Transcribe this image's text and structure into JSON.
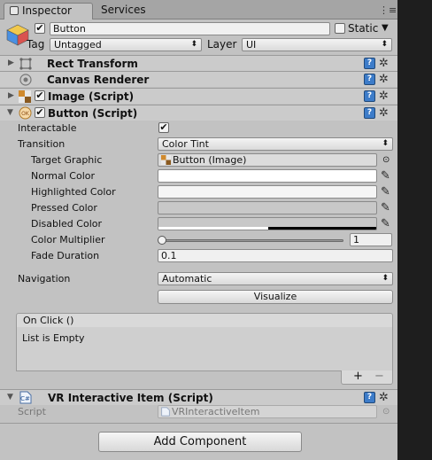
{
  "tabs": [
    {
      "label": "Inspector",
      "icon": "inspector-icon"
    },
    {
      "label": "Services"
    }
  ],
  "window_controls": {
    "menu": "⋮≡"
  },
  "gameobject": {
    "name": "Button",
    "active": true,
    "static_label": "Static",
    "tag_label": "Tag",
    "tag_value": "Untagged",
    "layer_label": "Layer",
    "layer_value": "UI"
  },
  "components": {
    "rect_transform": {
      "title": "Rect Transform"
    },
    "canvas_renderer": {
      "title": "Canvas Renderer"
    },
    "image": {
      "title": "Image (Script)",
      "enabled": true
    },
    "button": {
      "title": "Button (Script)",
      "enabled": true,
      "interactable_label": "Interactable",
      "interactable": true,
      "transition_label": "Transition",
      "transition_value": "Color Tint",
      "target_graphic_label": "Target Graphic",
      "target_graphic_value": "Button (Image)",
      "normal_color_label": "Normal Color",
      "highlighted_color_label": "Highlighted Color",
      "pressed_color_label": "Pressed Color",
      "disabled_color_label": "Disabled Color",
      "color_multiplier_label": "Color Multiplier",
      "color_multiplier_value": "1",
      "fade_duration_label": "Fade Duration",
      "fade_duration_value": "0.1",
      "navigation_label": "Navigation",
      "navigation_value": "Automatic",
      "visualize_label": "Visualize",
      "on_click_label": "On Click ()",
      "on_click_empty": "List is Empty",
      "add_symbol": "+",
      "remove_symbol": "−"
    },
    "vr_item": {
      "title": "VR Interactive Item (Script)",
      "script_label": "Script",
      "script_value": "VRInteractiveItem"
    }
  },
  "add_component_label": "Add Component",
  "colors": {
    "panel": "#c2c2c2",
    "normal": "#ffffff",
    "highlighted": "#f5f5f5",
    "pressed": "#c8c8c8",
    "disabled": "#c8c8c8",
    "accent": "#3d7cc9"
  }
}
